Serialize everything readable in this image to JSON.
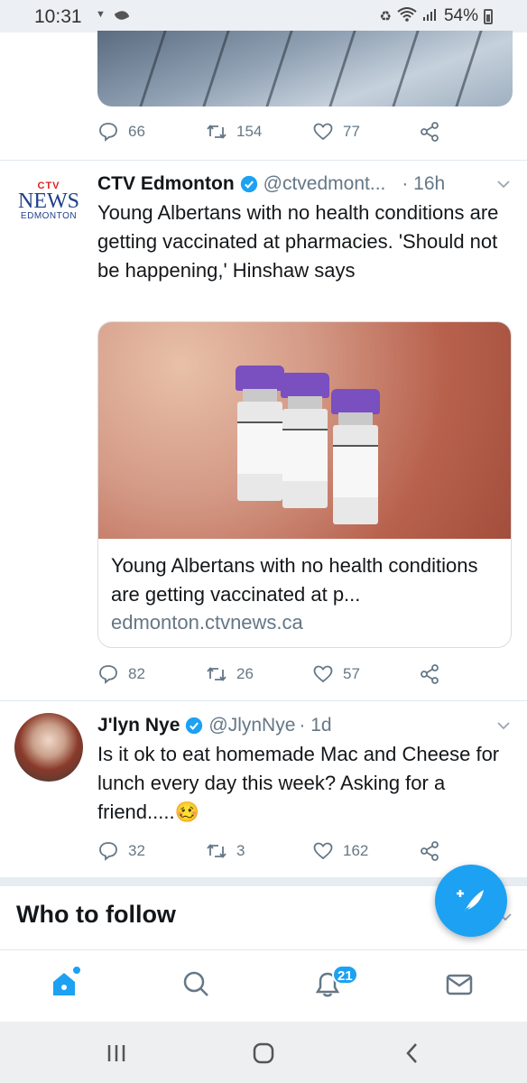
{
  "status_bar": {
    "time": "10:31",
    "battery": "54%"
  },
  "tweets": [
    {
      "actions": {
        "replies": "66",
        "retweets": "154",
        "likes": "77"
      }
    },
    {
      "logo": {
        "mark": "CTV",
        "news": "NEWS",
        "city": "EDMONTON"
      },
      "name": "CTV Edmonton",
      "handle": "@ctvedmont...",
      "time": "· 16h",
      "text": "Young Albertans with no health conditions are getting vaccinated at pharmacies. 'Should not be happening,' Hinshaw says",
      "card": {
        "title": "Young Albertans with no health conditions are getting vaccinated at p...",
        "domain": "edmonton.ctvnews.ca"
      },
      "actions": {
        "replies": "82",
        "retweets": "26",
        "likes": "57"
      }
    },
    {
      "name": "J'lyn Nye",
      "handle": "@JlynNye",
      "time": "· 1d",
      "text": "Is it ok to eat homemade Mac and Cheese for lunch every day this week? Asking for a friend.....🥴",
      "actions": {
        "replies": "32",
        "retweets": "3",
        "likes": "162"
      }
    }
  ],
  "who_to_follow": {
    "title": "Who to follow"
  },
  "bottom_nav": {
    "items": [
      "home-icon",
      "search-icon",
      "notifications-icon",
      "messages-icon"
    ],
    "notifications_badge": "21"
  },
  "colors": {
    "accent": "#1da1f2",
    "secondary_text": "#657786"
  }
}
